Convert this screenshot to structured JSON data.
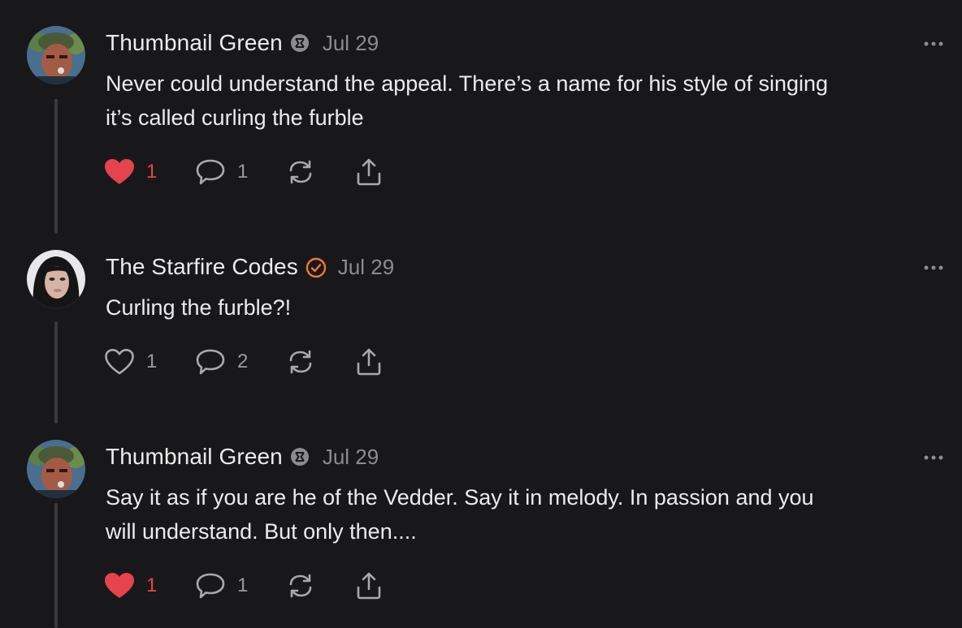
{
  "comments": [
    {
      "author": "Thumbnail Green",
      "badge": "community-badge-icon",
      "date": "Jul 29",
      "text_lines": [
        "Never could understand the appeal. There’s a name for his style of singing",
        "it’s called curling the furble"
      ],
      "likes": "1",
      "liked": true,
      "replies": "1"
    },
    {
      "author": "The Starfire Codes",
      "badge": "verified-check-icon",
      "date": "Jul 29",
      "text_lines": [
        "Curling the furble?!"
      ],
      "likes": "1",
      "liked": false,
      "replies": "2"
    },
    {
      "author": "Thumbnail Green",
      "badge": "community-badge-icon",
      "date": "Jul 29",
      "text_lines": [
        "Say it as if you are he of the Vedder. Say it in melody. In passion and you",
        "will understand. But only then...."
      ],
      "likes": "1",
      "liked": true,
      "replies": "1"
    }
  ],
  "colors": {
    "background": "#18181a",
    "like_active": "#e5434d",
    "verified": "#f07a2c",
    "muted": "#8c8c8f"
  }
}
